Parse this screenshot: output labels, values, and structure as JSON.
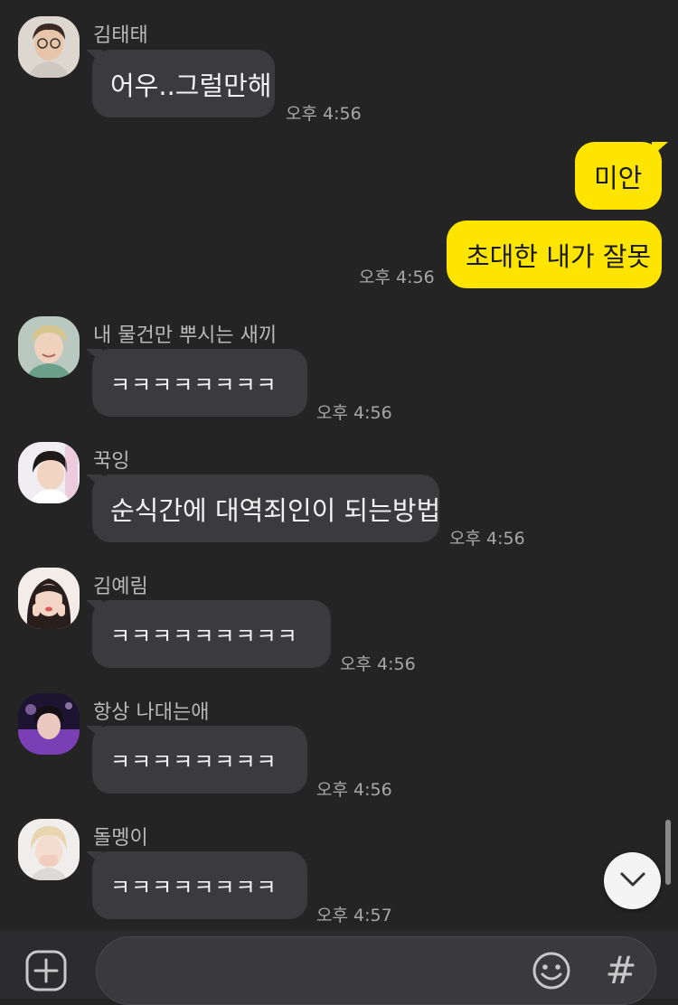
{
  "messages": [
    {
      "sender": "김태태",
      "text": "어우..그럴만해",
      "time": "오후 4:56"
    },
    {
      "mine": true,
      "text": "미안"
    },
    {
      "mine": true,
      "text": "초대한 내가 잘못",
      "time": "오후 4:56"
    },
    {
      "sender": "내 물건만 뿌시는 새끼",
      "text": "ㅋㅋㅋㅋㅋㅋㅋㅋ",
      "time": "오후 4:56"
    },
    {
      "sender": "꾹잉",
      "text": "순식간에 대역죄인이 되는방법",
      "time": "오후 4:56"
    },
    {
      "sender": "김예림",
      "text": "ㅋㅋㅋㅋㅋㅋㅋㅋㅋ",
      "time": "오후 4:56"
    },
    {
      "sender": "항상 나대는애",
      "text": "ㅋㅋㅋㅋㅋㅋㅋㅋ",
      "time": "오후 4:56"
    },
    {
      "sender": "돌멩이",
      "text": "ㅋㅋㅋㅋㅋㅋㅋㅋ",
      "time": "오후 4:57"
    }
  ],
  "composer": {
    "placeholder": "",
    "value": ""
  },
  "icons": {
    "add": "plus-circle-icon",
    "emoji": "smiley-icon",
    "hashtag": "hash-icon",
    "scroll": "chevron-down-icon"
  },
  "hash_symbol": "#",
  "colors": {
    "background": "#242425",
    "bubble_other": "#3b3b3d",
    "bubble_mine": "#fee500",
    "text_light": "#f2f2f2",
    "text_muted": "#a8a8a8"
  }
}
